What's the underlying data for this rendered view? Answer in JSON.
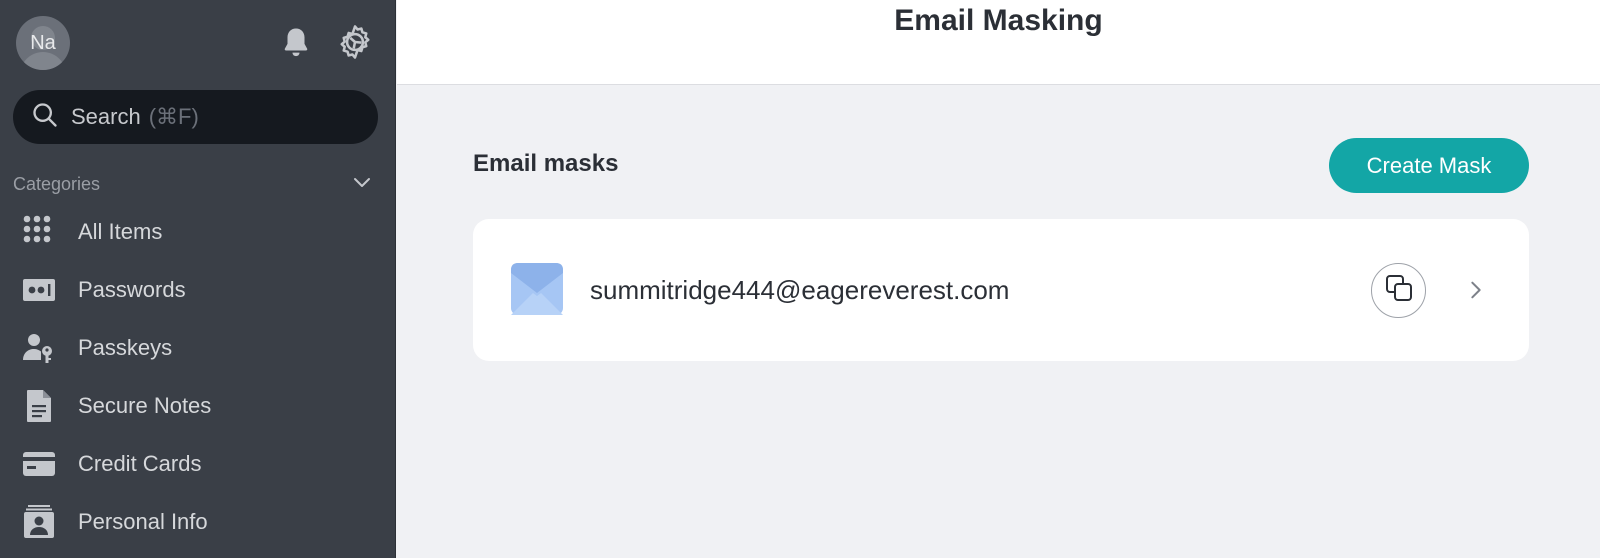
{
  "user": {
    "avatar_initials": "Na"
  },
  "search": {
    "label": "Search",
    "shortcut": "(⌘F)"
  },
  "categories": {
    "label": "Categories",
    "items": [
      {
        "label": "All Items",
        "icon": "grid-icon"
      },
      {
        "label": "Passwords",
        "icon": "password-icon"
      },
      {
        "label": "Passkeys",
        "icon": "passkey-icon"
      },
      {
        "label": "Secure Notes",
        "icon": "note-icon"
      },
      {
        "label": "Credit Cards",
        "icon": "credit-card-icon"
      },
      {
        "label": "Personal Info",
        "icon": "personal-info-icon"
      }
    ]
  },
  "header": {
    "title": "Email Masking"
  },
  "main": {
    "section_title": "Email masks",
    "create_button_label": "Create Mask",
    "masks": [
      {
        "email": "summitridge444@eagereverest.com"
      }
    ]
  },
  "colors": {
    "sidebar": "#3a3f47",
    "accent": "#13a6a6",
    "search_bg": "#15191f",
    "content_bg": "#f0f1f4"
  }
}
